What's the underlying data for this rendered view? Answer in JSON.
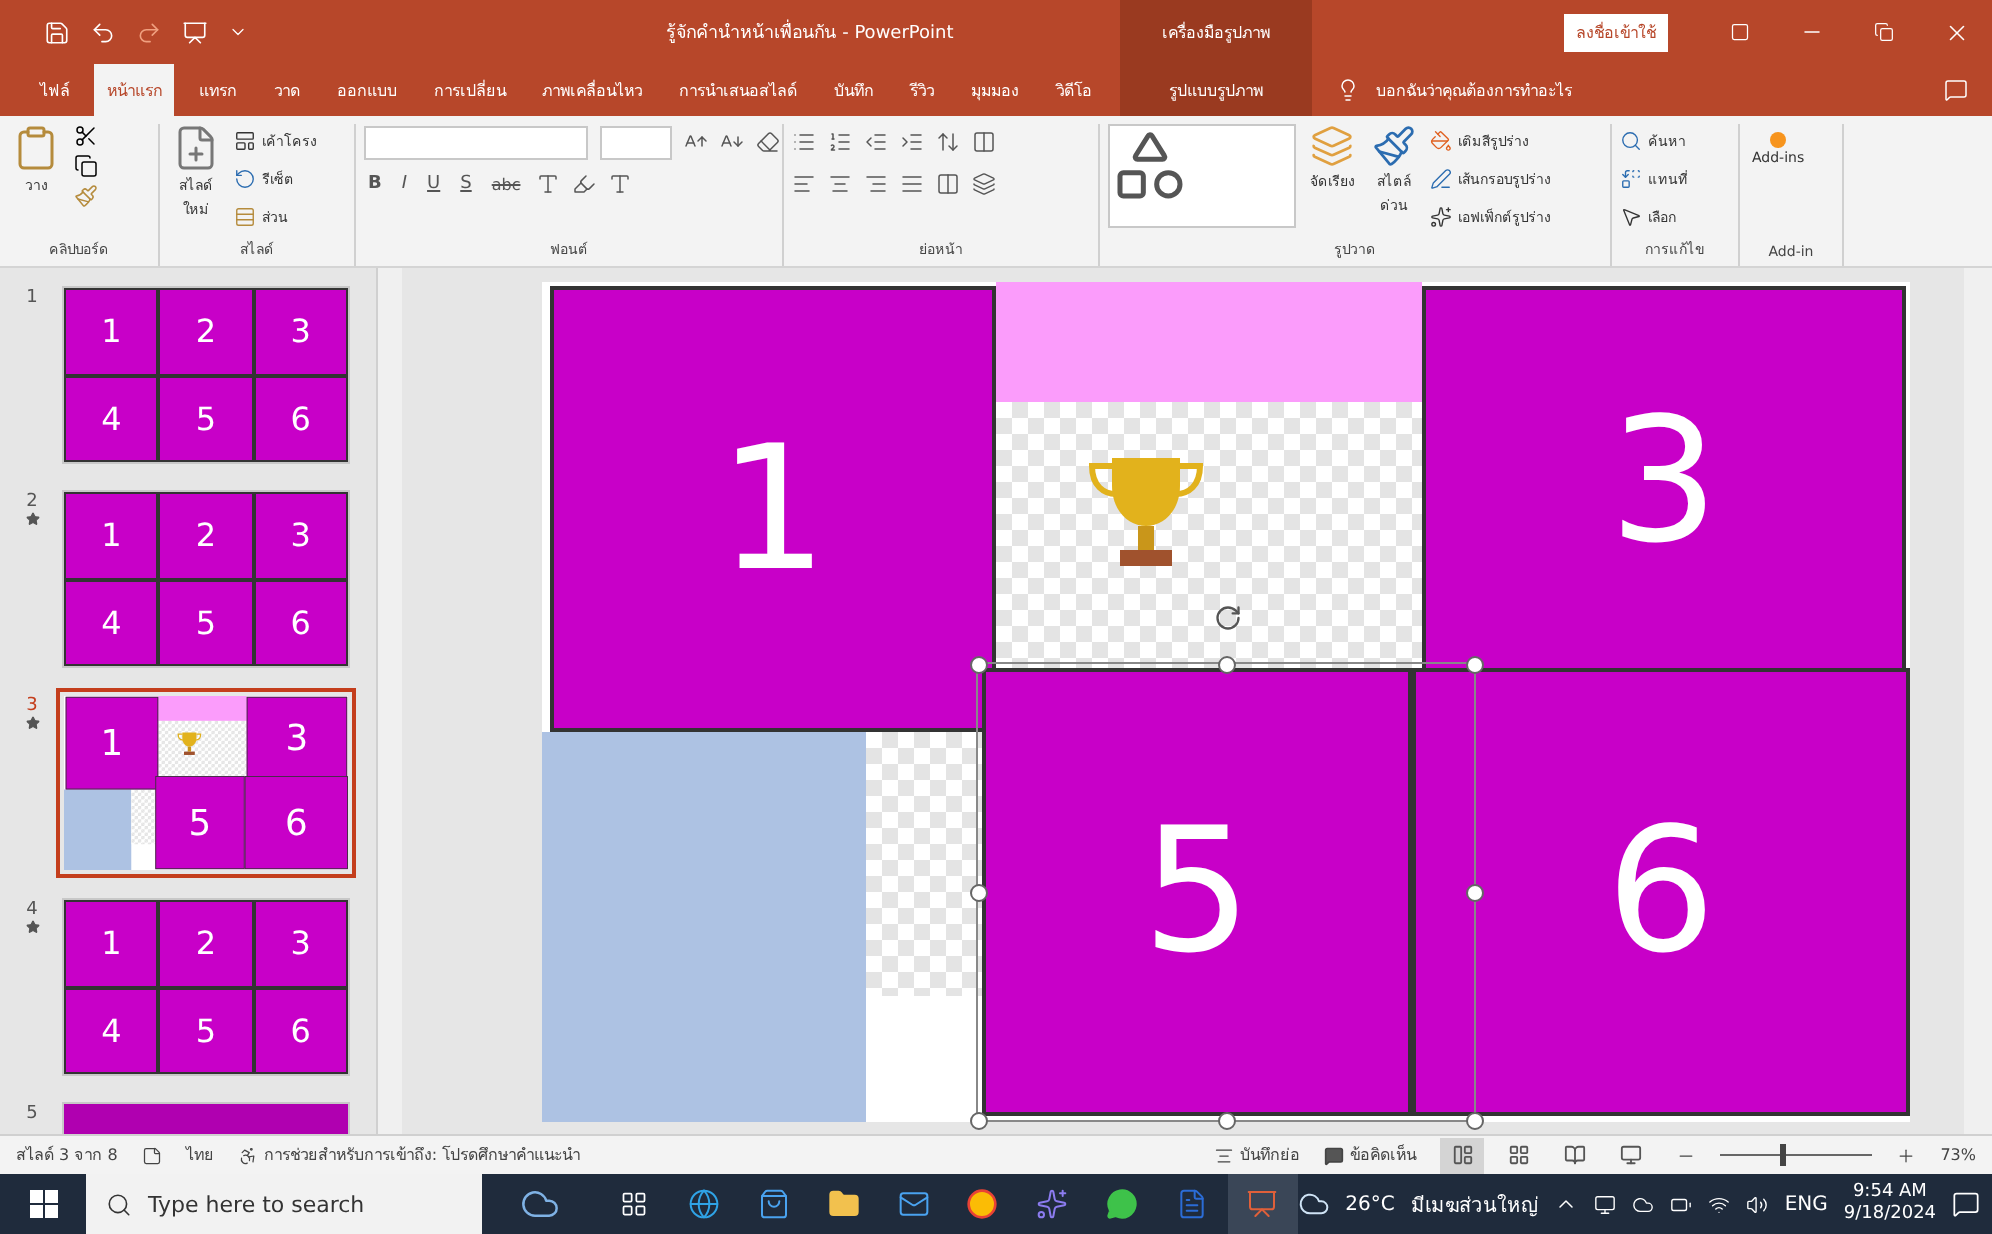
{
  "window": {
    "title": "รู้จักคำนำหน้าเพื่อนกัน - PowerPoint",
    "contextual_group": "เครื่องมือรูปภาพ",
    "sign_in": "ลงชื่อเข้าใช้"
  },
  "tabs": [
    {
      "label": "ไฟล์",
      "selected": false
    },
    {
      "label": "หน้าแรก",
      "selected": true
    },
    {
      "label": "แทรก",
      "selected": false
    },
    {
      "label": "วาด",
      "selected": false
    },
    {
      "label": "ออกแบบ",
      "selected": false
    },
    {
      "label": "การเปลี่ยน",
      "selected": false
    },
    {
      "label": "ภาพเคลื่อนไหว",
      "selected": false
    },
    {
      "label": "การนำเสนอสไลด์",
      "selected": false
    },
    {
      "label": "บันทึก",
      "selected": false
    },
    {
      "label": "รีวิว",
      "selected": false
    },
    {
      "label": "มุมมอง",
      "selected": false
    },
    {
      "label": "วิดีโอ",
      "selected": false
    }
  ],
  "contextual_tab": {
    "label": "รูปแบบรูปภาพ",
    "selected": false
  },
  "tell_me": "บอกฉันว่าคุณต้องการทำอะไร",
  "ribbon": {
    "clipboard": {
      "label": "คลิปบอร์ด",
      "paste": "วาง"
    },
    "slides": {
      "label": "สไลด์",
      "new_slide": [
        "สไลด์",
        "ใหม่"
      ],
      "layout": "เค้าโครง",
      "reset": "รีเซ็ต",
      "section": "ส่วน"
    },
    "font": {
      "label": "ฟอนต์",
      "format_buttons": [
        "B",
        "I",
        "U",
        "S",
        "abc"
      ]
    },
    "paragraph": {
      "label": "ย่อหน้า"
    },
    "drawing": {
      "label": "รูปวาด",
      "arrange": "จัดเรียง",
      "quick_styles": [
        "สไตล์",
        "ด่วน"
      ],
      "shape_fill": "เติมสีรูปร่าง",
      "shape_outline": "เส้นกรอบรูปร่าง",
      "shape_effects": "เอฟเฟ็กต์รูปร่าง"
    },
    "editing": {
      "label": "การแก้ไข",
      "find": "ค้นหา",
      "replace": "แทนที่",
      "select": "เลือก"
    },
    "addins": {
      "label": "Add-in",
      "button": "Add-ins"
    }
  },
  "slides": [
    {
      "number": "1",
      "animated": false,
      "selected": false,
      "kind": "grid",
      "tiles": [
        "1",
        "2",
        "3",
        "4",
        "5",
        "6"
      ]
    },
    {
      "number": "2",
      "animated": true,
      "selected": false,
      "kind": "grid",
      "tiles": [
        "1",
        "2",
        "3",
        "4",
        "5",
        "6"
      ]
    },
    {
      "number": "3",
      "animated": true,
      "selected": true,
      "kind": "canvas",
      "tiles": [
        "1",
        "3",
        "5",
        "6"
      ]
    },
    {
      "number": "4",
      "animated": true,
      "selected": false,
      "kind": "grid",
      "tiles": [
        "1",
        "2",
        "3",
        "4",
        "5",
        "6"
      ]
    },
    {
      "number": "5",
      "animated": false,
      "selected": false,
      "kind": "grid"
    }
  ],
  "slide": {
    "tiles": [
      "1",
      "3",
      "5",
      "6"
    ],
    "picture": {
      "selected": true
    }
  },
  "status_bar": {
    "slide_count": "สไลด์ 3 จาก 8",
    "language": "ไทย",
    "accessibility": "การช่วยสำหรับการเข้าถึง: โปรดศึกษาคำแนะนำ",
    "notes": "บันทึกย่อ",
    "comments": "ข้อคิดเห็น",
    "view_buttons": [
      {
        "selected": true
      },
      {
        "selected": false
      },
      {
        "selected": false
      },
      {
        "selected": false
      }
    ],
    "zoom": {
      "level": 0.4,
      "reading": "73%"
    }
  },
  "taskbar": {
    "search_placeholder": "Type here to search",
    "temperature": "26°C",
    "weather": "มีเมฆส่วนใหญ่",
    "language": "ENG",
    "time": "9:54 AM",
    "date": "9/18/2024"
  }
}
